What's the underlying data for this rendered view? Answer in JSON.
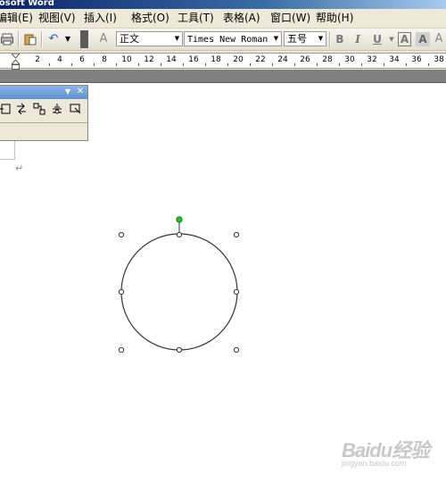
{
  "window": {
    "title": "rosoft Word"
  },
  "menubar": {
    "items": [
      {
        "label": "编辑(E)"
      },
      {
        "label": "视图(V)"
      },
      {
        "label": "插入(I)"
      },
      {
        "label": "格式(O)"
      },
      {
        "label": "工具(T)"
      },
      {
        "label": "表格(A)"
      },
      {
        "label": "窗口(W)"
      },
      {
        "label": "帮助(H)"
      }
    ]
  },
  "toolbar": {
    "style_value": "正文",
    "font_value": "Times New Roman",
    "size_value": "五号",
    "bold_label": "B",
    "italic_label": "I",
    "underline_label": "U",
    "char_border_label": "A",
    "char_shading_label": "A",
    "style_icon_label": "A"
  },
  "ruler": {
    "labels": [
      "2",
      "4",
      "6",
      "8",
      "10",
      "12",
      "14",
      "16",
      "18",
      "20",
      "22",
      "24",
      "26",
      "28",
      "30",
      "32",
      "34",
      "36",
      "38"
    ]
  },
  "document": {
    "paragraph_mark": "↵"
  },
  "watermark": {
    "logo": "Baidu经验",
    "sub": "jingyan.baidu.com"
  },
  "colors": {
    "rotation_handle": "#22c022",
    "title_blue": "#0a246a",
    "menu_bg": "#ece9d8"
  }
}
